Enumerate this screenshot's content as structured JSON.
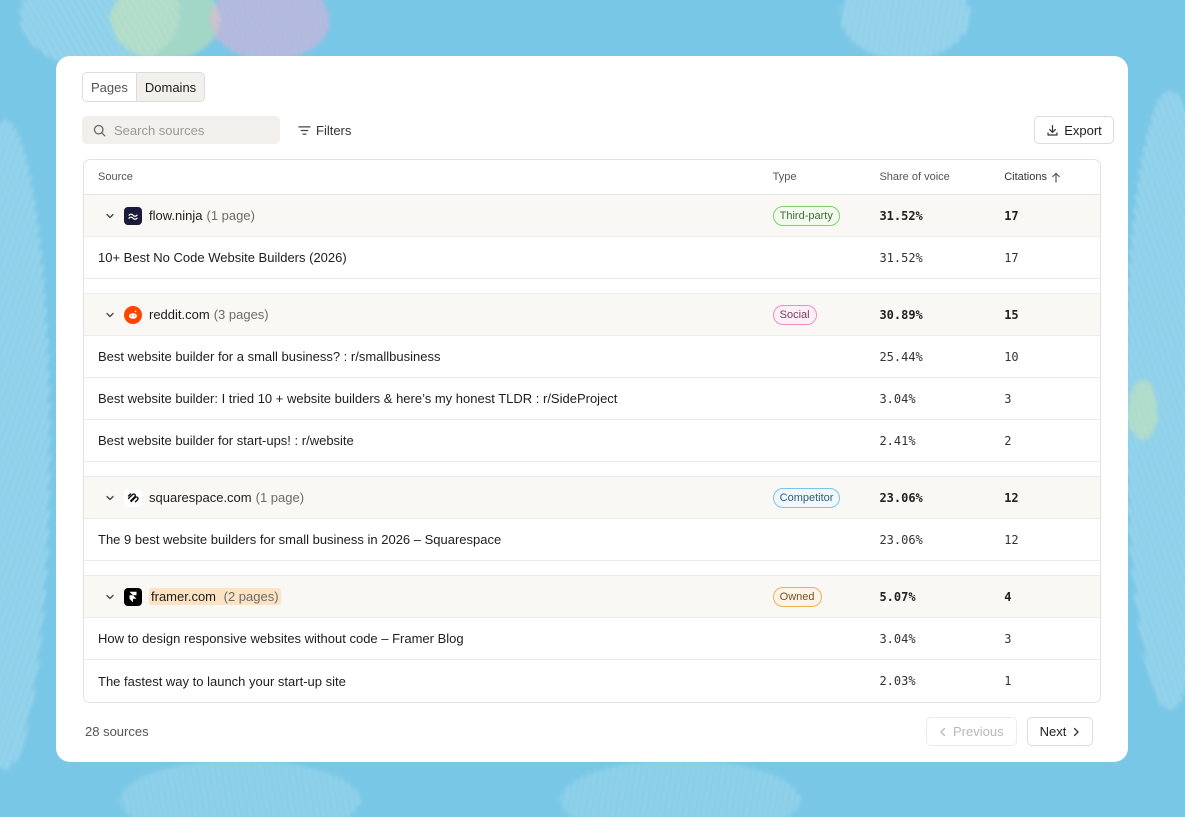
{
  "view_tabs": {
    "pages": "Pages",
    "domains": "Domains",
    "active": "Domains"
  },
  "search": {
    "placeholder": "Search sources",
    "value": ""
  },
  "filters_label": "Filters",
  "export_label": "Export",
  "table": {
    "headers": {
      "source": "Source",
      "type": "Type",
      "share": "Share of voice",
      "citations": "Citations"
    },
    "sort": {
      "column": "Citations",
      "direction": "ascending"
    },
    "groups": [
      {
        "domain": "flow.ninja",
        "count": "(1 page)",
        "type": "Third-party",
        "share": "31.52%",
        "citations": "17",
        "icon": "flow-ninja-favicon",
        "color": "#1b1a3a",
        "pages": [
          {
            "title": "10+ Best No Code Website Builders (2026)",
            "share": "31.52%",
            "citations": "17"
          }
        ]
      },
      {
        "domain": "reddit.com",
        "count": "(3 pages)",
        "type": "Social",
        "share": "30.89%",
        "citations": "15",
        "icon": "reddit-favicon",
        "color": "#ff4500",
        "pages": [
          {
            "title": "Best website builder for a small business? : r/smallbusiness",
            "share": "25.44%",
            "citations": "10"
          },
          {
            "title": "Best website builder: I tried 10 + website builders & here’s my honest TLDR : r/SideProject",
            "share": "3.04%",
            "citations": "3"
          },
          {
            "title": "Best website builder for start-ups! : r/website",
            "share": "2.41%",
            "citations": "2"
          }
        ]
      },
      {
        "domain": "squarespace.com",
        "count": "(1 page)",
        "type": "Competitor",
        "share": "23.06%",
        "citations": "12",
        "icon": "squarespace-favicon",
        "color": "#111111",
        "pages": [
          {
            "title": "The 9 best website builders for small business in 2026 – Squarespace",
            "share": "23.06%",
            "citations": "12"
          }
        ]
      },
      {
        "domain": "framer.com",
        "count": "(2 pages)",
        "type": "Owned",
        "share": "5.07%",
        "citations": "4",
        "icon": "framer-favicon",
        "color": "#000000",
        "pages": [
          {
            "title": "How to design responsive websites without code – Framer Blog",
            "share": "3.04%",
            "citations": "3"
          },
          {
            "title": "The fastest way to launch your start-up site",
            "share": "2.03%",
            "citations": "1"
          }
        ]
      }
    ]
  },
  "footer": {
    "count": "28 sources",
    "previous": "Previous",
    "next": "Next"
  }
}
